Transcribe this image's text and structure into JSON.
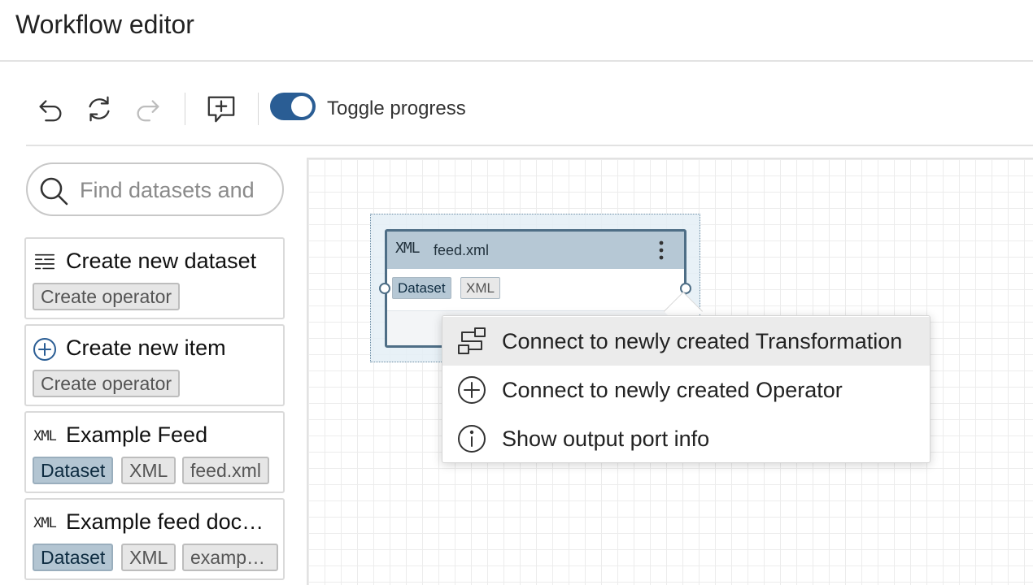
{
  "header": {
    "title": "Workflow editor"
  },
  "toolbar": {
    "undo_icon": "undo-icon",
    "reset_icon": "reset-icon",
    "redo_icon": "redo-icon",
    "add_note_icon": "add-note-icon",
    "toggle_label": "Toggle progress",
    "toggle_on": true
  },
  "sidebar": {
    "search": {
      "placeholder": "Find datasets and",
      "value": ""
    },
    "cards": [
      {
        "icon": "dataset-form-icon",
        "title": "Create new dataset",
        "tags": [
          "Create operator"
        ]
      },
      {
        "icon": "plus-circle-icon",
        "title": "Create new item",
        "tags": [
          "Create operator"
        ]
      },
      {
        "icon": "xml-icon",
        "icon_text": "XML",
        "title": "Example Feed",
        "tags": [
          "Dataset",
          "XML",
          "feed.xml"
        ]
      },
      {
        "icon": "xml-icon",
        "icon_text": "XML",
        "title": "Example feed doc…",
        "tags": [
          "Dataset",
          "XML",
          "examp…"
        ]
      }
    ]
  },
  "canvas": {
    "node": {
      "icon_text": "XML",
      "title": "feed.xml",
      "tags": [
        "Dataset",
        "XML"
      ]
    }
  },
  "context_menu": {
    "items": [
      {
        "icon": "transformation-icon",
        "label": "Connect to newly created Transformation",
        "active": true
      },
      {
        "icon": "plus-circle-icon",
        "label": "Connect to newly created Operator",
        "active": false
      },
      {
        "icon": "info-icon",
        "label": "Show output port info",
        "active": false
      }
    ]
  },
  "colors": {
    "accent": "#2a5d94",
    "dataset_tag": "#b3c5d2",
    "node_border": "#4e6e86"
  }
}
